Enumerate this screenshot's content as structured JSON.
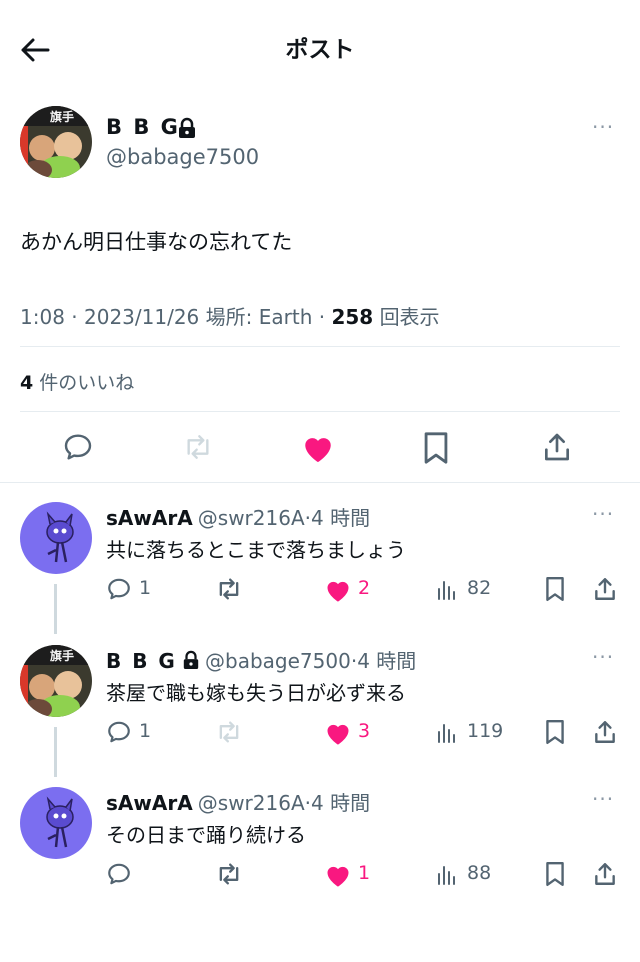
{
  "header": {
    "title": "ポスト"
  },
  "post": {
    "name": "B B G",
    "handle": "@babage7500",
    "text": "あかん明日仕事なの忘れてた",
    "time": "1:08",
    "date": "2023/11/26",
    "location_label": "場所: Earth",
    "views": "258",
    "views_label": "回表示",
    "likes_count": "4",
    "likes_label": "件のいいね",
    "more": "···",
    "sep": "·"
  },
  "replies": [
    {
      "name": "sAwArA",
      "handle": "@swr216A",
      "time": "4 時間",
      "text": "共に落ちるとこまで落ちましょう",
      "reply_count": "1",
      "like_count": "2",
      "views": "82",
      "retweet_active": true
    },
    {
      "name": "B B G",
      "handle": "@babage7500",
      "time": "4 時間",
      "text": "茶屋で職も嫁も失う日が必ず来る",
      "reply_count": "1",
      "like_count": "3",
      "views": "119",
      "retweet_active": false
    },
    {
      "name": "sAwArA",
      "handle": "@swr216A",
      "time": "4 時間",
      "text": "その日まで踊り続ける",
      "reply_count": "",
      "like_count": "1",
      "views": "88",
      "retweet_active": true
    }
  ],
  "colors": {
    "like": "#f91880",
    "text": "#0f1419",
    "secondary": "#536471",
    "avatar_purple": "#7b6ef0"
  },
  "icons": [
    "back-arrow-icon",
    "lock-icon",
    "reply-icon",
    "retweet-icon",
    "heart-icon",
    "bookmark-icon",
    "share-icon",
    "views-icon",
    "more-icon"
  ]
}
